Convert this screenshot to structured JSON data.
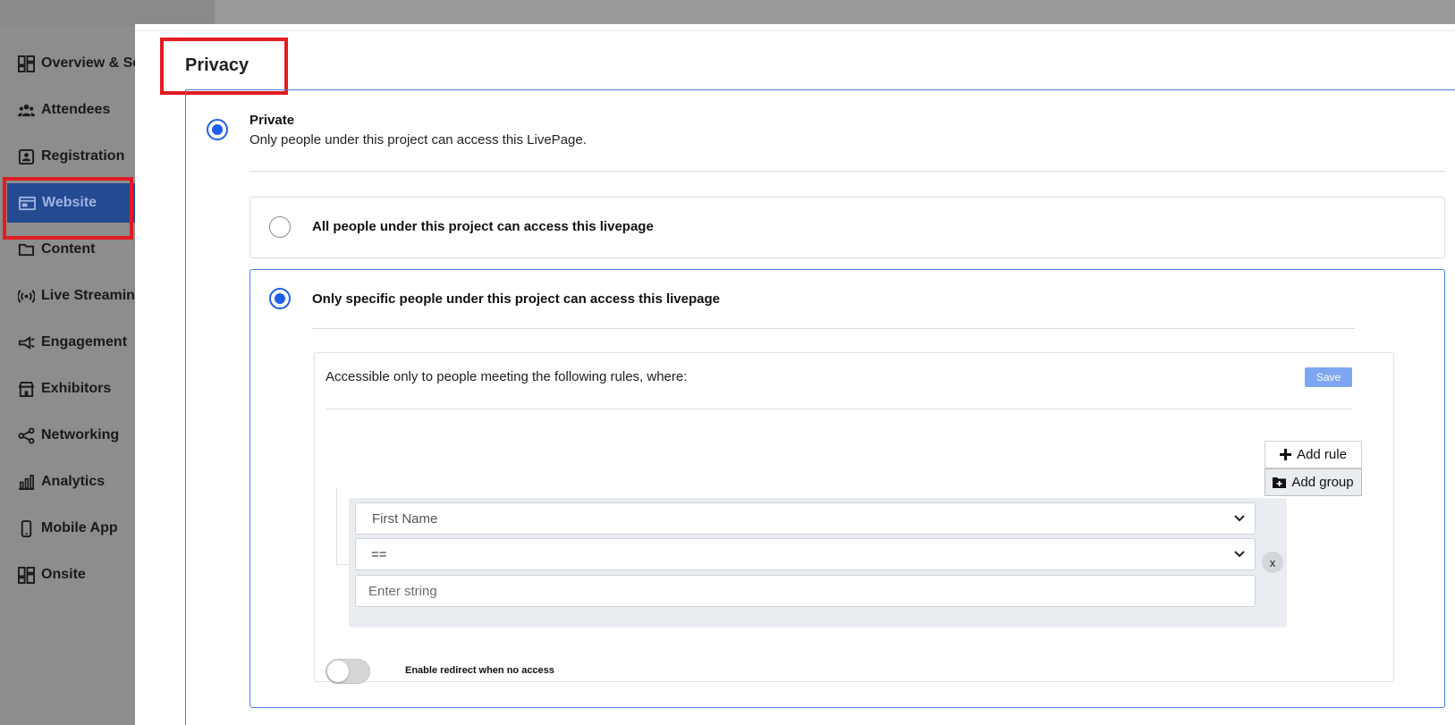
{
  "sidebar": {
    "items": [
      {
        "label": "Overview & Settings",
        "icon": "dashboard-icon"
      },
      {
        "label": "Attendees",
        "icon": "people-icon"
      },
      {
        "label": "Registration",
        "icon": "registration-icon"
      },
      {
        "label": "Website",
        "icon": "website-icon",
        "active": true
      },
      {
        "label": "Content",
        "icon": "folder-icon"
      },
      {
        "label": "Live Streaming",
        "icon": "broadcast-icon"
      },
      {
        "label": "Engagement",
        "icon": "megaphone-icon"
      },
      {
        "label": "Exhibitors",
        "icon": "store-icon"
      },
      {
        "label": "Networking",
        "icon": "share-icon"
      },
      {
        "label": "Analytics",
        "icon": "bar-chart-icon"
      },
      {
        "label": "Mobile App",
        "icon": "phone-icon"
      },
      {
        "label": "Onsite",
        "icon": "grid-icon"
      }
    ]
  },
  "privacy": {
    "title": "Privacy",
    "private_label": "Private",
    "private_desc": "Only people under this project can access this LivePage.",
    "option_all": "All people under this project can access this livepage",
    "option_specific": "Only specific people under this project can access this livepage",
    "rules_text": "Accessible only to people meeting the following rules, where:",
    "save_label": "Save",
    "add_rule_label": "Add rule",
    "add_group_label": "Add group",
    "rule": {
      "field": "First Name",
      "operator": "==",
      "value_placeholder": "Enter string"
    },
    "remove_label": "x",
    "redirect_label": "Enable redirect when no access"
  },
  "colors": {
    "accent": "#1e5fe8",
    "sidebar_active_bg": "#244a92",
    "highlight_box": "#e11b22",
    "save_button": "#7ea6f2"
  }
}
